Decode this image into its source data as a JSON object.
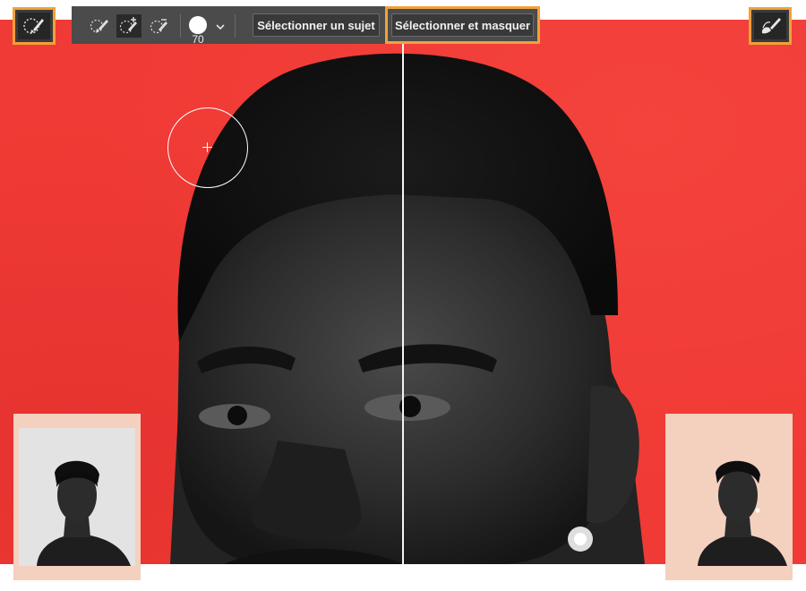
{
  "colors": {
    "canvas_red": "#f03a35",
    "highlight_orange": "#f2a03a",
    "toolbar_bg": "#4b4b4b",
    "thumbnail_bg": "#f4d0bf"
  },
  "toolbar": {
    "tools": [
      {
        "icon": "quick-selection-brush-icon",
        "state": "normal"
      },
      {
        "icon": "quick-selection-add-icon",
        "state": "active"
      },
      {
        "icon": "quick-selection-subtract-icon",
        "state": "normal"
      }
    ],
    "brush_size": "70",
    "select_subject_label": "Sélectionner un sujet",
    "select_and_mask_label": "Sélectionner et masquer"
  },
  "corner_tools": {
    "left_icon": "quick-selection-tool-icon",
    "right_icon": "refine-edge-brush-icon"
  },
  "thumbnails": {
    "before": "portrait-original-gray-background",
    "after": "portrait-on-peach-background"
  }
}
